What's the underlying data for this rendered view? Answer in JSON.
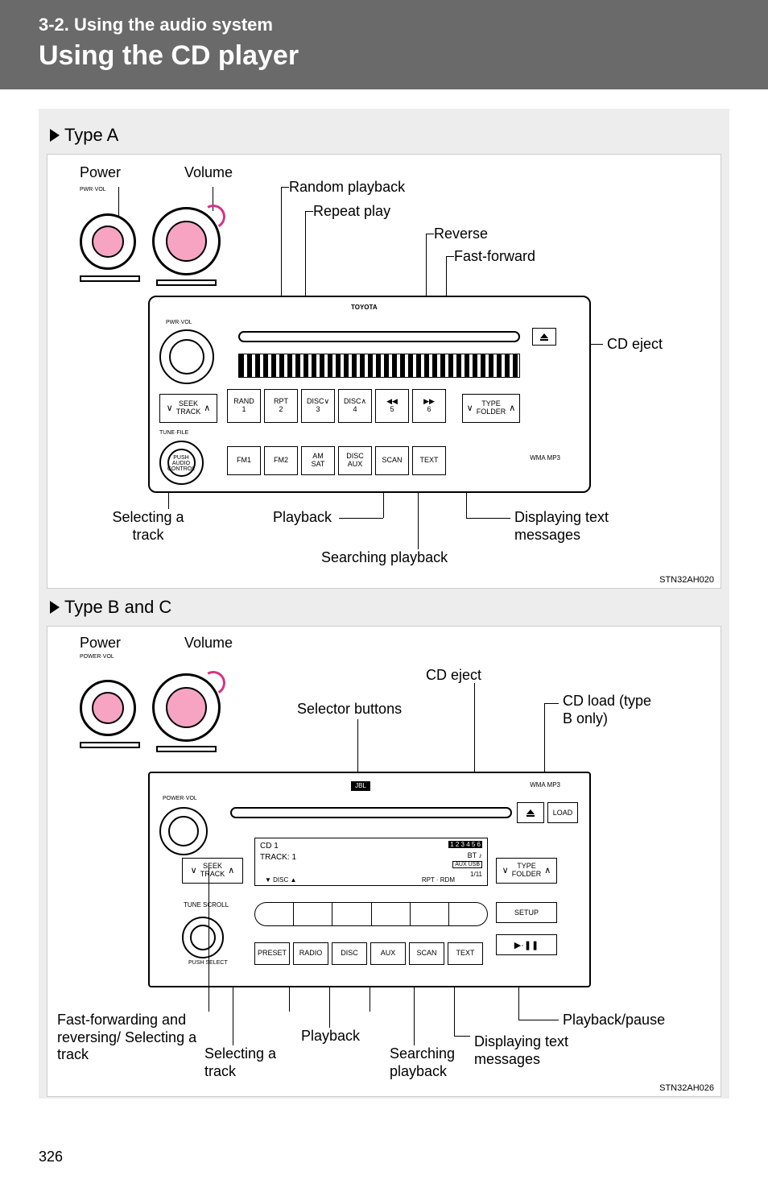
{
  "header": {
    "section": "3-2. Using the audio system",
    "title": "Using the CD player"
  },
  "typeA": {
    "heading": "Type A",
    "labels": {
      "power": "Power",
      "volume": "Volume",
      "random": "Random playback",
      "repeat": "Repeat play",
      "reverse": "Reverse",
      "ffwd": "Fast-forward",
      "eject": "CD eject",
      "selectTrack": "Selecting a track",
      "playback": "Playback",
      "search": "Searching playback",
      "displayText": "Displaying text messages"
    },
    "unit": {
      "pwrvol_tiny": "PWR·VOL",
      "brand": "TOYOTA",
      "pwrvol_panel": "PWR·VOL",
      "seek_top": "SEEK",
      "seek_bot": "TRACK",
      "btn1_top": "RAND",
      "btn1_bot": "1",
      "btn2_top": "RPT",
      "btn2_bot": "2",
      "btn3_top": "DISC∨",
      "btn3_bot": "3",
      "btn4_top": "DISC∧",
      "btn4_bot": "4",
      "btn5_top": "◀◀",
      "btn5_bot": "5",
      "btn6_top": "▶▶",
      "btn6_bot": "6",
      "type_top": "TYPE",
      "type_bot": "FOLDER",
      "tunefile": "TUNE·FILE",
      "push_audio": "PUSH AUDIO CONTROL",
      "r2_1": "FM1",
      "r2_2": "FM2",
      "r2_3_top": "AM",
      "r2_3_bot": "SAT",
      "r2_4_top": "DISC",
      "r2_4_bot": "AUX",
      "r2_5": "SCAN",
      "r2_6": "TEXT",
      "wma": "WMA MP3"
    },
    "imgcode": "STN32AH020"
  },
  "typeBC": {
    "heading": "Type B and C",
    "labels": {
      "power": "Power",
      "volume": "Volume",
      "eject": "CD eject",
      "selector": "Selector buttons",
      "load": "CD load (type B only)",
      "ffrev": "Fast-forwarding and reversing/ Selecting a track",
      "selectTrack": "Selecting a track",
      "playback": "Playback",
      "search": "Searching playback",
      "displayText": "Displaying text messages",
      "playpause": "Playback/pause"
    },
    "unit": {
      "powervol_tiny": "POWER·VOL",
      "powervol_panel": "POWER·VOL",
      "jbl": "JBL",
      "wma": "WMA MP3",
      "load": "LOAD",
      "disp_cd": "CD 1",
      "disp_track": "TRACK: 1",
      "disp_badge1": "1 2 3 4 5 6",
      "disp_bt": "BT",
      "disp_aux": "AUX USB",
      "disp_count": "1/11",
      "seek_top": "SEEK",
      "seek_bot": "TRACK",
      "disc": "DISC",
      "rpt": "RPT",
      "rdm": "RDM",
      "type_top": "TYPE",
      "type_bot": "FOLDER",
      "tune": "TUNE SCROLL",
      "setup": "SETUP",
      "push": "PUSH SELECT",
      "playpause": "▶·❚❚",
      "r_preset": "PRESET",
      "r_radio": "RADIO",
      "r_disc": "DISC",
      "r_aux": "AUX",
      "r_scan": "SCAN",
      "r_text": "TEXT"
    },
    "imgcode": "STN32AH026"
  },
  "pagenum": "326"
}
